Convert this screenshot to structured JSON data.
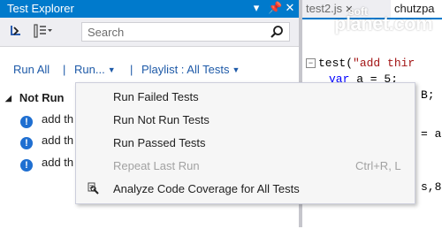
{
  "test_explorer": {
    "title": "Test Explorer",
    "title_controls": [
      "▾",
      "⊕",
      "✕"
    ],
    "search_placeholder": "Search",
    "run_bar": {
      "run_all": "Run All",
      "run": "Run...",
      "separator": "|",
      "playlist": "Playlist : All Tests"
    },
    "group_header": "Not Run",
    "tests": [
      {
        "label": "add th",
        "icon": "info-icon"
      },
      {
        "label": "add th",
        "icon": "info-icon"
      },
      {
        "label": "add th",
        "icon": "info-icon"
      }
    ]
  },
  "editor": {
    "tabs": [
      {
        "label": "test2.js",
        "close": "✕"
      },
      {
        "label": "chutzpa"
      }
    ],
    "code_lines": [
      {
        "prefix": "test(",
        "string": "\"add thir"
      },
      {
        "keyword": "var",
        "rest": " a = 5;"
      },
      {
        "rest": "B;"
      },
      {
        "rest": "= a"
      },
      {
        "rest": "s,8"
      }
    ],
    "watermark": "planet.com",
    "watermark_small": "soft"
  },
  "run_menu": {
    "items": [
      {
        "label": "Run Failed Tests",
        "enabled": true
      },
      {
        "label": "Run Not Run Tests",
        "enabled": true
      },
      {
        "label": "Run Passed Tests",
        "enabled": true
      },
      {
        "label": "Repeat Last Run",
        "shortcut": "Ctrl+R, L",
        "enabled": false
      },
      {
        "label": "Analyze Code Coverage for All Tests",
        "enabled": true,
        "icon": "code-coverage-icon"
      }
    ]
  },
  "colors": {
    "accent": "#007acc",
    "link": "#1e5aa8",
    "info_icon": "#1f6fd1"
  }
}
